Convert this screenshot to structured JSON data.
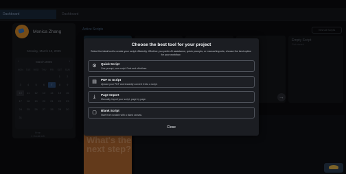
{
  "tabs": {
    "active": "Dashboard",
    "second": "Dashboard"
  },
  "profile": {
    "name": "Monica Zhang"
  },
  "calendar": {
    "today_line": "Monday, March 10, 2025",
    "month": "March 2025",
    "dow": [
      "MON",
      "TUE",
      "WED",
      "THU",
      "FRI",
      "SAT",
      "SUN"
    ],
    "days": [
      "",
      "",
      "",
      "",
      "",
      "1",
      "2",
      "3",
      "4",
      "5",
      "6",
      "7",
      "8",
      "9",
      "10",
      "11",
      "12",
      "13",
      "14",
      "15",
      "16",
      "17",
      "18",
      "19",
      "20",
      "21",
      "22",
      "23",
      "24",
      "25",
      "26",
      "27",
      "28",
      "29",
      "30",
      "31",
      "",
      "",
      "",
      "",
      "",
      ""
    ]
  },
  "plan": {
    "line1": "Free",
    "line2": "1 Credit left"
  },
  "main": {
    "section_title": "Active Scripts",
    "view_all": "View All Scripts",
    "view_all_2": "View All Projects"
  },
  "empty_card": {
    "title": "Empty Script",
    "sub": "Get started"
  },
  "promo": {
    "text": "What's the next step?"
  },
  "modal": {
    "title": "Choose the best tool for your project",
    "subtitle": "Select the ideal tool to create your script efficiently. Whether you prefer AI assistance, quick prompts, or manual imports, choose the best option for your workflow.",
    "options": [
      {
        "title": "Quick Script",
        "desc": "One prompt, one script. Fast and effortless.",
        "icon": "gear-icon"
      },
      {
        "title": "PDF to Script",
        "desc": "Upload your PDF and instantly convert it into a script.",
        "icon": "document-icon"
      },
      {
        "title": "Page Import",
        "desc": "Manually import your script, page by page.",
        "icon": "import-icon"
      },
      {
        "title": "Blank Script",
        "desc": "Start from scratch with a blank canvas.",
        "icon": "blank-page-icon"
      }
    ],
    "close": "Close"
  }
}
